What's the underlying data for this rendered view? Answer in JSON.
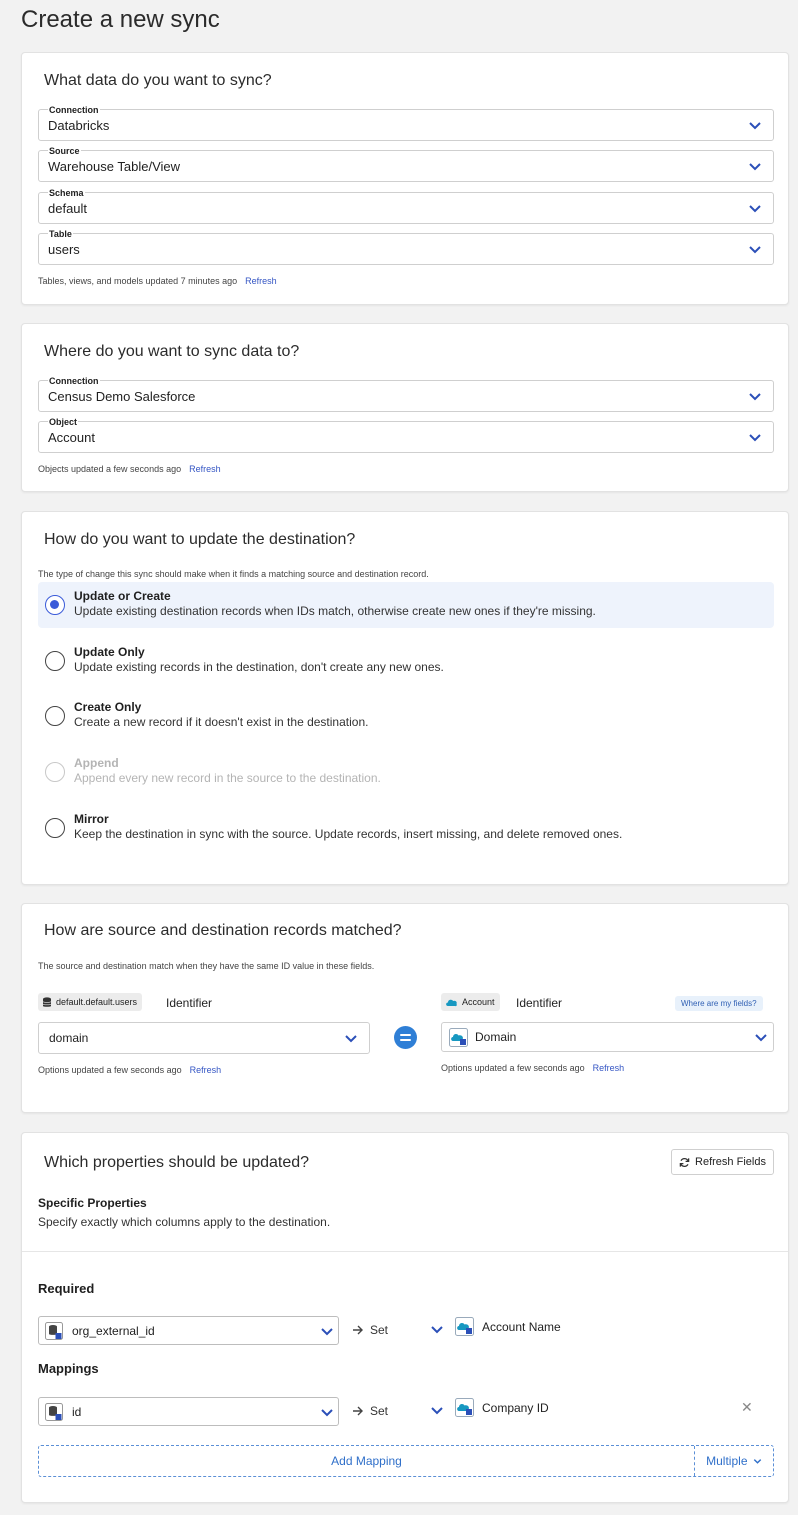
{
  "page": {
    "title": "Create a new sync"
  },
  "source_card": {
    "title": "What data do you want to sync?",
    "fields": [
      {
        "label": "Connection",
        "value": "Databricks"
      },
      {
        "label": "Source",
        "value": "Warehouse Table/View"
      },
      {
        "label": "Schema",
        "value": "default"
      },
      {
        "label": "Table",
        "value": "users"
      }
    ],
    "meta": "Tables, views, and models updated 7 minutes ago",
    "refresh": "Refresh"
  },
  "dest_card": {
    "title": "Where do you want to sync data to?",
    "fields": [
      {
        "label": "Connection",
        "value": "Census Demo Salesforce"
      },
      {
        "label": "Object",
        "value": "Account"
      }
    ],
    "meta": "Objects updated a few seconds ago",
    "refresh": "Refresh"
  },
  "behavior_card": {
    "title": "How do you want to update the destination?",
    "hint": "The type of change this sync should make when it finds a matching source and destination record.",
    "options": [
      {
        "title": "Update or Create",
        "desc": "Update existing destination records when IDs match, otherwise create new ones if they're missing.",
        "selected": true
      },
      {
        "title": "Update Only",
        "desc": "Update existing records in the destination, don't create any new ones."
      },
      {
        "title": "Create Only",
        "desc": "Create a new record if it doesn't exist in the destination."
      },
      {
        "title": "Append",
        "desc": "Append every new record in the source to the destination.",
        "disabled": true
      },
      {
        "title": "Mirror",
        "desc": "Keep the destination in sync with the source. Update records, insert missing, and delete removed ones."
      }
    ]
  },
  "match_card": {
    "title": "How are source and destination records matched?",
    "hint": "The source and destination match when they have the same ID value in these fields.",
    "source_tag": "default.default.users",
    "dest_tag": "Account",
    "identifier": "Identifier",
    "where_link": "Where are my fields?",
    "source_value": "domain",
    "dest_value": "Domain",
    "source_meta": "Options updated a few seconds ago",
    "dest_meta": "Options updated a few seconds ago",
    "refresh": "Refresh"
  },
  "props_card": {
    "title": "Which properties should be updated?",
    "refresh_fields": "Refresh Fields",
    "specific_title": "Specific Properties",
    "specific_desc": "Specify exactly which columns apply to the destination.",
    "required_label": "Required",
    "mappings_label": "Mappings",
    "required": {
      "source": "org_external_id",
      "op": "Set",
      "dest": "Account Name"
    },
    "mapping": {
      "source": "id",
      "op": "Set",
      "dest": "Company ID"
    },
    "add_mapping": "Add Mapping",
    "multiple": "Multiple"
  },
  "colors": {
    "accent": "#3b5bd9",
    "link": "#3556c4",
    "selected_bg": "#eef3fc"
  }
}
